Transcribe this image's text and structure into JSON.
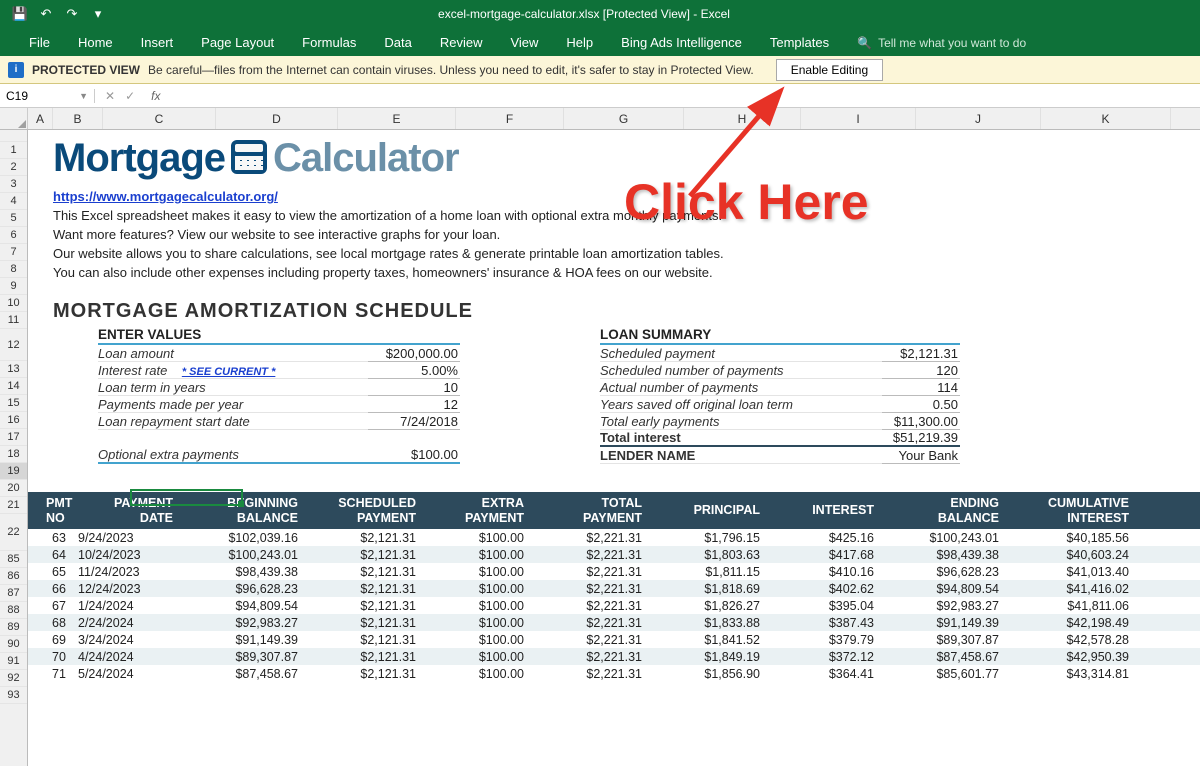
{
  "title": "excel-mortgage-calculator.xlsx  [Protected View]  -  Excel",
  "qat": {
    "save": "💾",
    "undo": "↶",
    "redo": "↷"
  },
  "tabs": [
    "File",
    "Home",
    "Insert",
    "Page Layout",
    "Formulas",
    "Data",
    "Review",
    "View",
    "Help",
    "Bing Ads Intelligence",
    "Templates"
  ],
  "tellme": "Tell me what you want to do",
  "protected": {
    "title": "PROTECTED VIEW",
    "message": "Be careful—files from the Internet can contain viruses. Unless you need to edit, it's safer to stay in Protected View.",
    "button": "Enable Editing"
  },
  "namebox": "C19",
  "fx": "fx",
  "columns": [
    {
      "label": "A",
      "w": 25
    },
    {
      "label": "B",
      "w": 50
    },
    {
      "label": "C",
      "w": 113
    },
    {
      "label": "D",
      "w": 122
    },
    {
      "label": "E",
      "w": 118
    },
    {
      "label": "F",
      "w": 108
    },
    {
      "label": "G",
      "w": 120
    },
    {
      "label": "H",
      "w": 117
    },
    {
      "label": "I",
      "w": 115
    },
    {
      "label": "J",
      "w": 125
    },
    {
      "label": "K",
      "w": 130
    }
  ],
  "rows_top": [
    "1",
    "2",
    "3",
    "4",
    "5",
    "6",
    "7",
    "8",
    "9",
    "10",
    "11"
  ],
  "rows_mid": [
    "12",
    "13",
    "14",
    "15",
    "16",
    "17",
    "18",
    "19",
    "20",
    "21"
  ],
  "rows_am_hdr": "22",
  "rows_am": [
    "85",
    "86",
    "87",
    "88",
    "89",
    "90",
    "91",
    "92",
    "93"
  ],
  "logo": {
    "part1": "Mortgage",
    "part2": "Calculator"
  },
  "intro": {
    "link": "https://www.mortgagecalculator.org/",
    "l1": "This Excel spreadsheet makes it easy to view the amortization of a home loan with optional extra monthly payments.",
    "l2": "Want more features? View our website to see interactive graphs for your loan.",
    "l3": "Our website allows you to share calculations, see local mortgage rates & generate printable loan amortization tables.",
    "l4": "You can also include other expenses including property taxes, homeowners' insurance & HOA fees on our website."
  },
  "schedule_title": "MORTGAGE AMORTIZATION SCHEDULE",
  "enter_values": {
    "header": "ENTER VALUES",
    "rows": [
      {
        "label": "Loan amount",
        "value": "$200,000.00"
      },
      {
        "label": "Interest rate",
        "link": "* SEE CURRENT *",
        "value": "5.00%"
      },
      {
        "label": "Loan term in years",
        "value": "10"
      },
      {
        "label": "Payments made per year",
        "value": "12"
      },
      {
        "label": "Loan repayment start date",
        "value": "7/24/2018"
      }
    ],
    "extra_label": "Optional extra payments",
    "extra_value": "$100.00"
  },
  "loan_summary": {
    "header": "LOAN SUMMARY",
    "rows": [
      {
        "label": "Scheduled payment",
        "value": "$2,121.31"
      },
      {
        "label": "Scheduled number of payments",
        "value": "120"
      },
      {
        "label": "Actual number of payments",
        "value": "114"
      },
      {
        "label": "Years saved off original loan term",
        "value": "0.50"
      },
      {
        "label": "Total early payments",
        "value": "$11,300.00"
      },
      {
        "label": "Total interest",
        "value": "$51,219.39"
      },
      {
        "label": "LENDER NAME",
        "value": "Your Bank"
      }
    ]
  },
  "am_headers": {
    "pmtno": "PMT\nNO",
    "date": "PAYMENT\nDATE",
    "beg": "BEGINNING\nBALANCE",
    "sched": "SCHEDULED\nPAYMENT",
    "extra": "EXTRA\nPAYMENT",
    "total": "TOTAL\nPAYMENT",
    "prin": "PRINCIPAL",
    "int": "INTEREST",
    "end": "ENDING\nBALANCE",
    "cum": "CUMULATIVE\nINTEREST"
  },
  "am_data": [
    {
      "no": "63",
      "date": "9/24/2023",
      "beg": "$102,039.16",
      "sched": "$2,121.31",
      "extra": "$100.00",
      "total": "$2,221.31",
      "prin": "$1,796.15",
      "int": "$425.16",
      "end": "$100,243.01",
      "cum": "$40,185.56"
    },
    {
      "no": "64",
      "date": "10/24/2023",
      "beg": "$100,243.01",
      "sched": "$2,121.31",
      "extra": "$100.00",
      "total": "$2,221.31",
      "prin": "$1,803.63",
      "int": "$417.68",
      "end": "$98,439.38",
      "cum": "$40,603.24"
    },
    {
      "no": "65",
      "date": "11/24/2023",
      "beg": "$98,439.38",
      "sched": "$2,121.31",
      "extra": "$100.00",
      "total": "$2,221.31",
      "prin": "$1,811.15",
      "int": "$410.16",
      "end": "$96,628.23",
      "cum": "$41,013.40"
    },
    {
      "no": "66",
      "date": "12/24/2023",
      "beg": "$96,628.23",
      "sched": "$2,121.31",
      "extra": "$100.00",
      "total": "$2,221.31",
      "prin": "$1,818.69",
      "int": "$402.62",
      "end": "$94,809.54",
      "cum": "$41,416.02"
    },
    {
      "no": "67",
      "date": "1/24/2024",
      "beg": "$94,809.54",
      "sched": "$2,121.31",
      "extra": "$100.00",
      "total": "$2,221.31",
      "prin": "$1,826.27",
      "int": "$395.04",
      "end": "$92,983.27",
      "cum": "$41,811.06"
    },
    {
      "no": "68",
      "date": "2/24/2024",
      "beg": "$92,983.27",
      "sched": "$2,121.31",
      "extra": "$100.00",
      "total": "$2,221.31",
      "prin": "$1,833.88",
      "int": "$387.43",
      "end": "$91,149.39",
      "cum": "$42,198.49"
    },
    {
      "no": "69",
      "date": "3/24/2024",
      "beg": "$91,149.39",
      "sched": "$2,121.31",
      "extra": "$100.00",
      "total": "$2,221.31",
      "prin": "$1,841.52",
      "int": "$379.79",
      "end": "$89,307.87",
      "cum": "$42,578.28"
    },
    {
      "no": "70",
      "date": "4/24/2024",
      "beg": "$89,307.87",
      "sched": "$2,121.31",
      "extra": "$100.00",
      "total": "$2,221.31",
      "prin": "$1,849.19",
      "int": "$372.12",
      "end": "$87,458.67",
      "cum": "$42,950.39"
    },
    {
      "no": "71",
      "date": "5/24/2024",
      "beg": "$87,458.67",
      "sched": "$2,121.31",
      "extra": "$100.00",
      "total": "$2,221.31",
      "prin": "$1,856.90",
      "int": "$364.41",
      "end": "$85,601.77",
      "cum": "$43,314.81"
    }
  ],
  "annotation": "Click Here"
}
